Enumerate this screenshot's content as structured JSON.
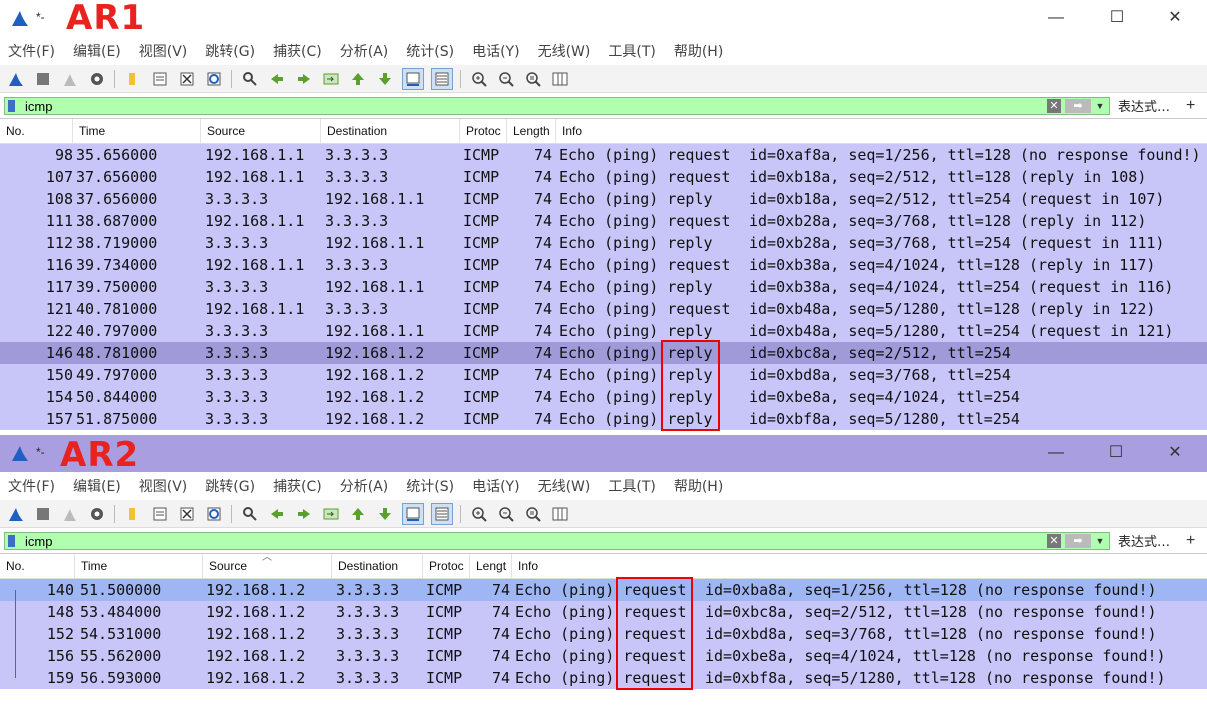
{
  "ar1": {
    "title": "*-",
    "label": "AR1",
    "menu": [
      "文件(F)",
      "编辑(E)",
      "视图(V)",
      "跳转(G)",
      "捕获(C)",
      "分析(A)",
      "统计(S)",
      "电话(Y)",
      "无线(W)",
      "工具(T)",
      "帮助(H)"
    ],
    "filter": "icmp",
    "filter_expression": "表达式…",
    "columns": [
      "No.",
      "Time",
      "Source",
      "Destination",
      "Protoc",
      "Length",
      "Info"
    ],
    "rows": [
      {
        "no": "98",
        "time": "35.656000",
        "src": "192.168.1.1",
        "dst": "3.3.3.3",
        "proto": "ICMP",
        "len": "74",
        "kind": "Echo (ping) request",
        "detail": "id=0xaf8a, seq=1/256, ttl=128 (no response found!)"
      },
      {
        "no": "107",
        "time": "37.656000",
        "src": "192.168.1.1",
        "dst": "3.3.3.3",
        "proto": "ICMP",
        "len": "74",
        "kind": "Echo (ping) request",
        "detail": "id=0xb18a, seq=2/512, ttl=128 (reply in 108)"
      },
      {
        "no": "108",
        "time": "37.656000",
        "src": "3.3.3.3",
        "dst": "192.168.1.1",
        "proto": "ICMP",
        "len": "74",
        "kind": "Echo (ping) reply",
        "detail": "id=0xb18a, seq=2/512, ttl=254 (request in 107)"
      },
      {
        "no": "111",
        "time": "38.687000",
        "src": "192.168.1.1",
        "dst": "3.3.3.3",
        "proto": "ICMP",
        "len": "74",
        "kind": "Echo (ping) request",
        "detail": "id=0xb28a, seq=3/768, ttl=128 (reply in 112)"
      },
      {
        "no": "112",
        "time": "38.719000",
        "src": "3.3.3.3",
        "dst": "192.168.1.1",
        "proto": "ICMP",
        "len": "74",
        "kind": "Echo (ping) reply",
        "detail": "id=0xb28a, seq=3/768, ttl=254 (request in 111)"
      },
      {
        "no": "116",
        "time": "39.734000",
        "src": "192.168.1.1",
        "dst": "3.3.3.3",
        "proto": "ICMP",
        "len": "74",
        "kind": "Echo (ping) request",
        "detail": "id=0xb38a, seq=4/1024, ttl=128 (reply in 117)"
      },
      {
        "no": "117",
        "time": "39.750000",
        "src": "3.3.3.3",
        "dst": "192.168.1.1",
        "proto": "ICMP",
        "len": "74",
        "kind": "Echo (ping) reply",
        "detail": "id=0xb38a, seq=4/1024, ttl=254 (request in 116)"
      },
      {
        "no": "121",
        "time": "40.781000",
        "src": "192.168.1.1",
        "dst": "3.3.3.3",
        "proto": "ICMP",
        "len": "74",
        "kind": "Echo (ping) request",
        "detail": "id=0xb48a, seq=5/1280, ttl=128 (reply in 122)"
      },
      {
        "no": "122",
        "time": "40.797000",
        "src": "3.3.3.3",
        "dst": "192.168.1.1",
        "proto": "ICMP",
        "len": "74",
        "kind": "Echo (ping) reply",
        "detail": "id=0xb48a, seq=5/1280, ttl=254 (request in 121)"
      },
      {
        "no": "146",
        "time": "48.781000",
        "src": "3.3.3.3",
        "dst": "192.168.1.2",
        "proto": "ICMP",
        "len": "74",
        "kind": "Echo (ping) reply",
        "detail": "id=0xbc8a, seq=2/512, ttl=254"
      },
      {
        "no": "150",
        "time": "49.797000",
        "src": "3.3.3.3",
        "dst": "192.168.1.2",
        "proto": "ICMP",
        "len": "74",
        "kind": "Echo (ping) reply",
        "detail": "id=0xbd8a, seq=3/768, ttl=254"
      },
      {
        "no": "154",
        "time": "50.844000",
        "src": "3.3.3.3",
        "dst": "192.168.1.2",
        "proto": "ICMP",
        "len": "74",
        "kind": "Echo (ping) reply",
        "detail": "id=0xbe8a, seq=4/1024, ttl=254"
      },
      {
        "no": "157",
        "time": "51.875000",
        "src": "3.3.3.3",
        "dst": "192.168.1.2",
        "proto": "ICMP",
        "len": "74",
        "kind": "Echo (ping) reply",
        "detail": "id=0xbf8a, seq=5/1280, ttl=254"
      }
    ],
    "selected_row": 9
  },
  "ar2": {
    "title": "*-",
    "label": "AR2",
    "menu": [
      "文件(F)",
      "编辑(E)",
      "视图(V)",
      "跳转(G)",
      "捕获(C)",
      "分析(A)",
      "统计(S)",
      "电话(Y)",
      "无线(W)",
      "工具(T)",
      "帮助(H)"
    ],
    "filter": "icmp",
    "filter_expression": "表达式…",
    "columns": [
      "No.",
      "Time",
      "Source",
      "Destination",
      "Protoc",
      "Lengt",
      "Info"
    ],
    "rows": [
      {
        "no": "140",
        "time": "51.500000",
        "src": "192.168.1.2",
        "dst": "3.3.3.3",
        "proto": "ICMP",
        "len": "74",
        "kind": "Echo (ping) request",
        "detail": "id=0xba8a, seq=1/256, ttl=128 (no response found!)"
      },
      {
        "no": "148",
        "time": "53.484000",
        "src": "192.168.1.2",
        "dst": "3.3.3.3",
        "proto": "ICMP",
        "len": "74",
        "kind": "Echo (ping) request",
        "detail": "id=0xbc8a, seq=2/512, ttl=128 (no response found!)"
      },
      {
        "no": "152",
        "time": "54.531000",
        "src": "192.168.1.2",
        "dst": "3.3.3.3",
        "proto": "ICMP",
        "len": "74",
        "kind": "Echo (ping) request",
        "detail": "id=0xbd8a, seq=3/768, ttl=128 (no response found!)"
      },
      {
        "no": "156",
        "time": "55.562000",
        "src": "192.168.1.2",
        "dst": "3.3.3.3",
        "proto": "ICMP",
        "len": "74",
        "kind": "Echo (ping) request",
        "detail": "id=0xbe8a, seq=4/1024, ttl=128 (no response found!)"
      },
      {
        "no": "159",
        "time": "56.593000",
        "src": "192.168.1.2",
        "dst": "3.3.3.3",
        "proto": "ICMP",
        "len": "74",
        "kind": "Echo (ping) request",
        "detail": "id=0xbf8a, seq=5/1280, ttl=128 (no response found!)"
      }
    ],
    "selected_row": 0
  },
  "window_controls": {
    "minimize": "—",
    "maximize": "☐",
    "close": "✕"
  },
  "colors": {
    "row_bg": "#c8c6f9",
    "selected_ar1": "#a09bd8",
    "selected_ar2": "#9eb6f3",
    "filter_ok": "#afffaf",
    "annotation": "#e8231f",
    "title_ar2": "#a99fe0"
  }
}
